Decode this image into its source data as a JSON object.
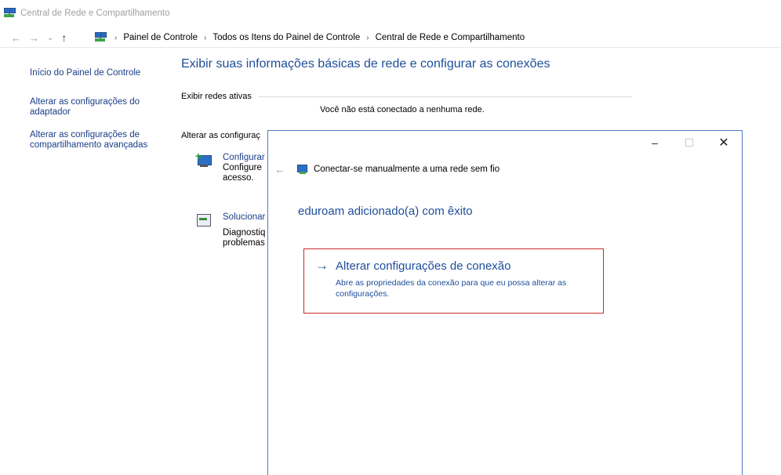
{
  "window": {
    "title": "Central de Rede e Compartilhamento"
  },
  "address_bar": {
    "breadcrumbs": [
      "Painel de Controle",
      "Todos os Itens do Painel de Controle",
      "Central de Rede e Compartilhamento"
    ]
  },
  "sidebar": {
    "items": [
      {
        "label": "Início do Painel de Controle"
      },
      {
        "label": "Alterar as configurações do adaptador"
      },
      {
        "label": "Alterar as configurações de compartilhamento avançadas"
      }
    ]
  },
  "main": {
    "title": "Exibir suas informações básicas de rede e configurar as conexões",
    "active_networks_label": "Exibir redes ativas",
    "no_network_text": "Você não está conectado a nenhuma rede.",
    "change_settings_label": "Alterar as configuraç",
    "items": [
      {
        "title": "Configurar",
        "desc": "Configure acesso."
      },
      {
        "title": "Solucionar",
        "desc": "Diagnostiq problemas"
      }
    ]
  },
  "dialog": {
    "title": "Conectar-se manualmente a uma rede sem fio",
    "success_message": "eduroam adicionado(a) com êxito",
    "option": {
      "title": "Alterar configurações de conexão",
      "description": "Abre as propriedades da conexão para que eu possa alterar as configurações."
    },
    "controls": {
      "minimize": "–",
      "maximize": "☐",
      "close": "✕"
    }
  },
  "icons": {
    "back": "←",
    "forward": "→",
    "dropdown": "⌄",
    "up": "↑",
    "breadcrumb_separator": "›",
    "option_arrow": "→"
  }
}
